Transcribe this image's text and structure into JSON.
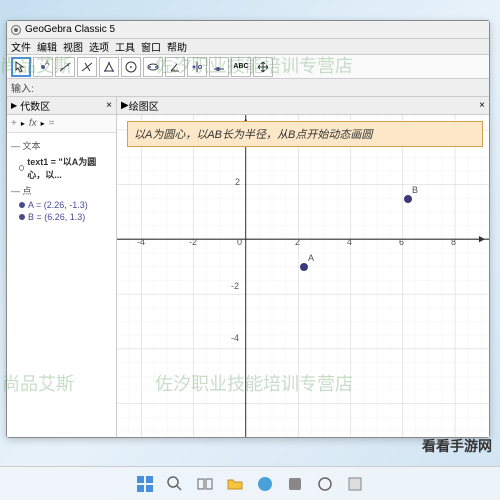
{
  "window": {
    "title": "GeoGebra Classic 5"
  },
  "menu": {
    "items": [
      "文件",
      "编辑",
      "视图",
      "选项",
      "工具",
      "窗口",
      "帮助"
    ]
  },
  "input": {
    "label": "输入:"
  },
  "panels": {
    "algebra": {
      "title": "代数区",
      "close": "×"
    },
    "graph": {
      "title": "绘图区",
      "close": "×"
    }
  },
  "fx": {
    "plus": "+",
    "fx": "fx",
    "eq": "=",
    "arrow": "▸"
  },
  "algebra": {
    "sec_text": "— 文本",
    "text1": "text1 = \"以A为圆心，以...",
    "sec_point": "— 点",
    "pointA": "A = (2.26, -1.3)",
    "pointB": "B = (6.26, 1.3)"
  },
  "banner": {
    "text": "以A为圆心，以AB长为半径，从B点开始动态画圆"
  },
  "axes": {
    "x": [
      "-4",
      "-2",
      "2",
      "4",
      "6",
      "8"
    ],
    "y": [
      "2",
      "-2",
      "-4"
    ],
    "origin": "0"
  },
  "points": {
    "A": {
      "label": "A"
    },
    "B": {
      "label": "B"
    }
  },
  "watermarks": {
    "a": "尚品艾斯",
    "b": "佐汐职业技能培训专营店"
  },
  "credit": "看看手游网",
  "chart_data": {
    "type": "scatter",
    "title": "以A为圆心，以AB长为半径，从B点开始动态画圆",
    "xlabel": "",
    "ylabel": "",
    "xlim": [
      -5,
      9
    ],
    "ylim": [
      -5,
      3
    ],
    "series": [
      {
        "name": "A",
        "values": [
          [
            2.26,
            -1.3
          ]
        ]
      },
      {
        "name": "B",
        "values": [
          [
            6.26,
            1.3
          ]
        ]
      }
    ]
  }
}
